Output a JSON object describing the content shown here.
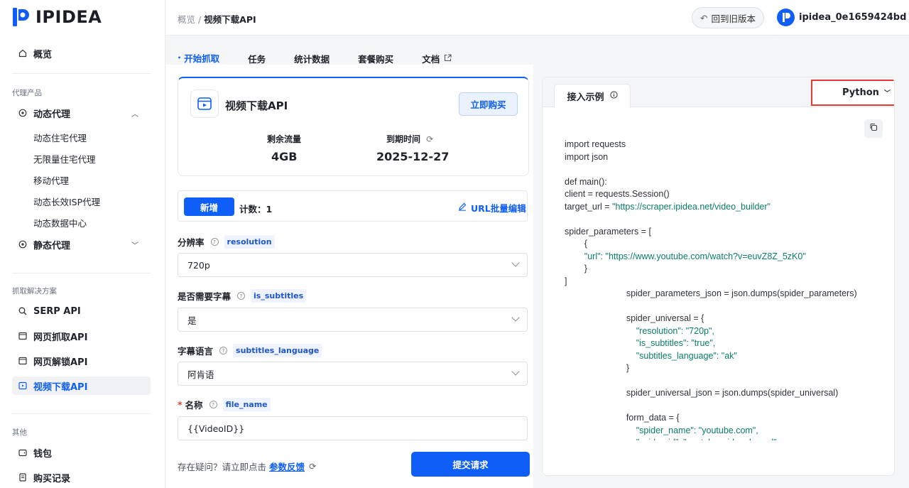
{
  "brand": {
    "name": "IPIDEA"
  },
  "sidebar": {
    "overview": "概览",
    "section_proxy": "代理产品",
    "dynamic_proxy": "动态代理",
    "dynamic_sub": [
      "动态住宅代理",
      "无限量住宅代理",
      "移动代理",
      "动态长效ISP代理",
      "动态数据中心"
    ],
    "static_proxy": "静态代理",
    "section_scrape": "抓取解决方案",
    "serp_api": "SERP API",
    "web_scrape_api": "网页抓取API",
    "web_unlock_api": "网页解锁API",
    "video_api": "视频下载API",
    "section_other": "其他",
    "wallet": "钱包",
    "purchase_records": "购买记录"
  },
  "header": {
    "breadcrumb_root": "概览 /",
    "breadcrumb_current": "视频下载API",
    "old_version_label": "回到旧版本",
    "username": "ipidea_0e1659424bd"
  },
  "tabs": [
    {
      "label": "开始抓取",
      "active": true
    },
    {
      "label": "任务"
    },
    {
      "label": "统计数据"
    },
    {
      "label": "套餐购买"
    },
    {
      "label": "文档"
    }
  ],
  "product": {
    "title": "视频下载API",
    "buy_label": "立即购买",
    "remaining_label": "剩余流量",
    "remaining_value": "4GB",
    "expire_label": "到期时间",
    "expire_value": "2025-12-27"
  },
  "counter": {
    "add_label": "新增",
    "count_text": "计数：1",
    "url_edit_label": "URL批量编辑"
  },
  "form": {
    "resolution": {
      "label": "分辨率",
      "tag": "resolution",
      "value": "720p"
    },
    "subtitles": {
      "label": "是否需要字幕",
      "tag": "is_subtitles",
      "value": "是"
    },
    "language": {
      "label": "字幕语言",
      "tag": "subtitles_language",
      "value": "阿肯语"
    },
    "name": {
      "label": "名称",
      "tag": "file_name",
      "value": "{{VideoID}}"
    }
  },
  "footer": {
    "question_text": "存在疑问？请立即点击",
    "feedback_link": "参数反馈",
    "submit_label": "提交请求"
  },
  "example": {
    "tab_label": "接入示例",
    "language": "Python",
    "code_lines": [
      {
        "t": "import requests"
      },
      {
        "t": "import json"
      },
      {
        "t": ""
      },
      {
        "t": "def main():"
      },
      {
        "t": "client = requests.Session()"
      },
      {
        "t": "target_url = ",
        "s": "\"https://scraper.ipidea.net/video_builder\""
      },
      {
        "t": ""
      },
      {
        "t": "spider_parameters = ["
      },
      {
        "t": "        {"
      },
      {
        "t": "        ",
        "s": "\"url\": \"https://www.youtube.com/watch?v=euvZ8Z_5zK0\""
      },
      {
        "t": "        }"
      },
      {
        "t": "]"
      },
      {
        "t": "                         spider_parameters_json = json.dumps(spider_parameters)"
      },
      {
        "t": ""
      },
      {
        "t": "                         spider_universal = {"
      },
      {
        "t": "                             ",
        "s": "\"resolution\": \"720p\","
      },
      {
        "t": "                             ",
        "s": "\"is_subtitles\": \"true\","
      },
      {
        "t": "                             ",
        "s": "\"subtitles_language\": \"ak\""
      },
      {
        "t": "                         }"
      },
      {
        "t": ""
      },
      {
        "t": "                         spider_universal_json = json.dumps(spider_universal)"
      },
      {
        "t": ""
      },
      {
        "t": "                         form_data = {"
      },
      {
        "t": "                             ",
        "s": "\"spider_name\": \"youtube.com\","
      },
      {
        "t": "                             ",
        "s": "\"spider_id\": \"youtube_video_by_url\","
      }
    ]
  },
  "colors": {
    "accent": "#0f5ef7",
    "highlight": "#e53935",
    "string": "#0b7d67"
  }
}
